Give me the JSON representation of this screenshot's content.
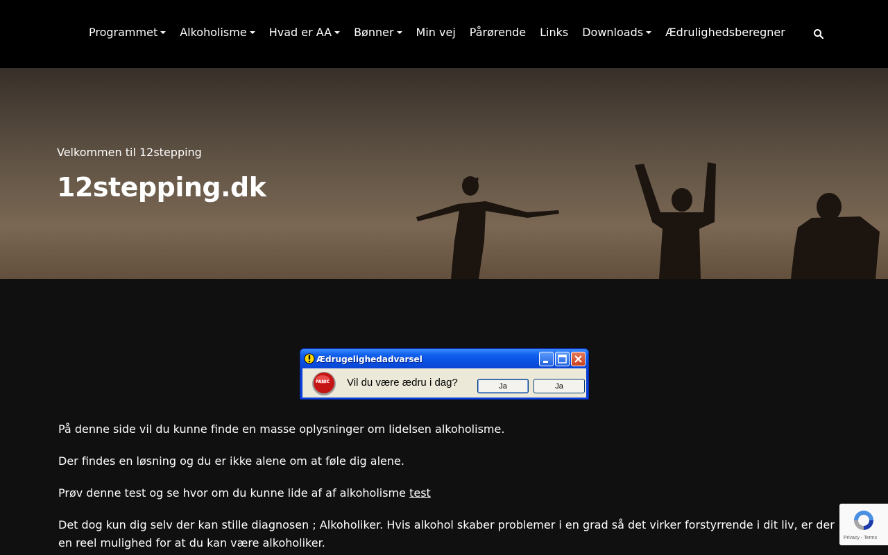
{
  "nav": {
    "items": [
      {
        "label": "Programmet",
        "dropdown": true
      },
      {
        "label": "Alkoholisme",
        "dropdown": true
      },
      {
        "label": "Hvad er AA",
        "dropdown": true
      },
      {
        "label": "Bønner",
        "dropdown": true
      },
      {
        "label": "Min vej",
        "dropdown": false
      },
      {
        "label": "Pårørende",
        "dropdown": false
      },
      {
        "label": "Links",
        "dropdown": false
      },
      {
        "label": "Downloads",
        "dropdown": true
      },
      {
        "label": "Ædrulighedsberegner",
        "dropdown": false
      }
    ],
    "search_icon": "search-icon"
  },
  "hero": {
    "kicker": "Velkommen til 12stepping",
    "title": "12stepping.dk"
  },
  "dialog": {
    "title": "Ædrugelighedadvarsel",
    "message": "Vil du være ædru i dag?",
    "button_1": "Ja",
    "button_2": "Ja",
    "panic_label": "PANIC"
  },
  "content": {
    "p1": "På denne side vil du kunne finde en masse oplysninger om lidelsen alkoholisme.",
    "p2": "Der findes en løsning og du er ikke alene om at føle dig alene.",
    "p3_text": "Prøv denne test og se hvor om du kunne lide af af alkoholisme ",
    "p3_link": "test",
    "p4": "Det dog kun dig selv der kan stille diagnosen ; Alkoholiker. Hvis alkohol skaber problemer i en grad så det virker forstyrrende i dit liv, er der en reel mulighed for at du kan være alkoholiker."
  },
  "recaptcha": {
    "privacy": "Privacy",
    "terms": "Terms"
  },
  "colors": {
    "nav_bg": "#000000",
    "page_bg": "#101010",
    "xp_blue": "#0a4ee0"
  }
}
